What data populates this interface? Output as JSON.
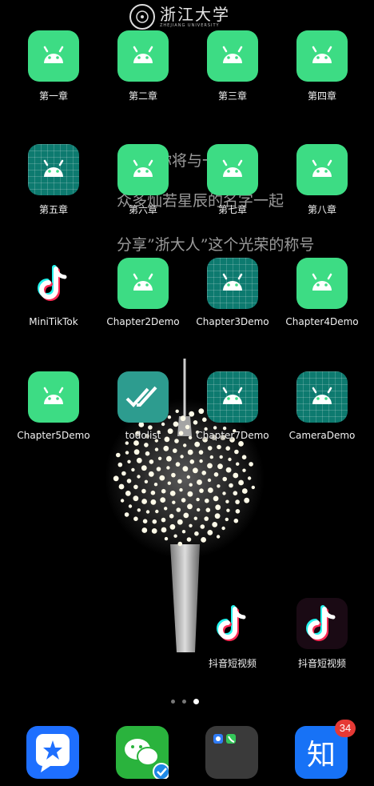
{
  "header": {
    "logo_text": "浙江大学",
    "logo_subtext": "ZHEJIANG UNIVERSITY"
  },
  "wallpaper": {
    "slogan_lines": [
      "你将与一批",
      "众多灿若星辰的名字一起",
      "分享”浙大人”这个光荣的称号"
    ]
  },
  "apps": [
    {
      "label": "第一章",
      "icon": "android-icon",
      "style": "green"
    },
    {
      "label": "第二章",
      "icon": "android-icon",
      "style": "green"
    },
    {
      "label": "第三章",
      "icon": "android-icon",
      "style": "green"
    },
    {
      "label": "第四章",
      "icon": "android-icon",
      "style": "green"
    },
    {
      "label": "第五章",
      "icon": "android-icon",
      "style": "teal"
    },
    {
      "label": "第六章",
      "icon": "android-icon",
      "style": "green"
    },
    {
      "label": "第七章",
      "icon": "android-icon",
      "style": "green"
    },
    {
      "label": "第八章",
      "icon": "android-icon",
      "style": "green"
    },
    {
      "label": "MiniTikTok",
      "icon": "tiktok-icon",
      "style": "tiktok"
    },
    {
      "label": "Chapter2Demo",
      "icon": "android-icon",
      "style": "green"
    },
    {
      "label": "Chapter3Demo",
      "icon": "android-icon",
      "style": "teal"
    },
    {
      "label": "Chapter4Demo",
      "icon": "android-icon",
      "style": "green"
    },
    {
      "label": "Chapter5Demo",
      "icon": "android-icon",
      "style": "green"
    },
    {
      "label": "todolist",
      "icon": "checkmark-icon",
      "style": "todo"
    },
    {
      "label": "Chapter7Demo",
      "icon": "android-icon",
      "style": "teal"
    },
    {
      "label": "CameraDemo",
      "icon": "android-icon",
      "style": "teal"
    },
    {
      "label": "抖音短视频",
      "icon": "tiktok-icon",
      "style": "tiktok"
    },
    {
      "label": "抖音短视频",
      "icon": "tiktok-icon",
      "style": "tiktok-dark"
    }
  ],
  "pager": {
    "pages": 3,
    "current": 3
  },
  "dock": [
    {
      "name": "dingtalk-icon",
      "color": "#1e6fff"
    },
    {
      "name": "wechat-icon",
      "color": "#2ab33d"
    },
    {
      "name": "folder-icon",
      "color": "#4a4a4a"
    },
    {
      "name": "zhihu-icon",
      "color": "#1772f6",
      "label": "知",
      "badge": "34"
    }
  ],
  "colors": {
    "android_green": "#3ddc84",
    "android_teal": "#0d7a6f",
    "tiktok_cyan": "#25f4ee",
    "tiktok_red": "#fe2c55"
  }
}
